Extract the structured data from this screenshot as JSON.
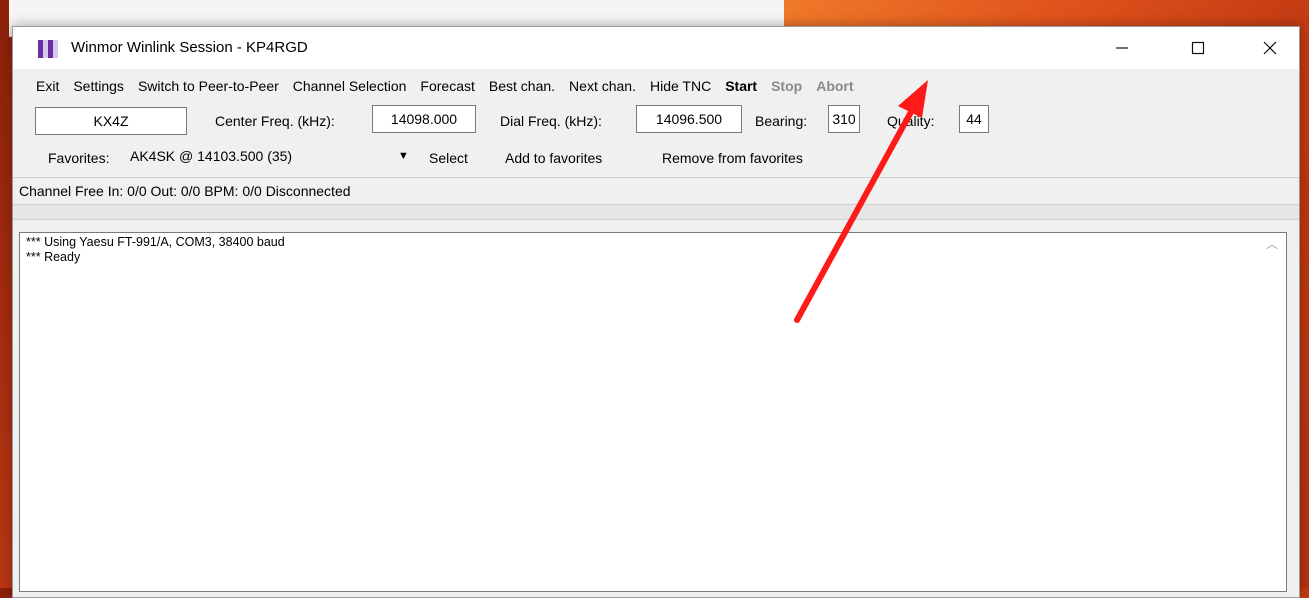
{
  "window": {
    "title": "Winmor Winlink Session - KP4RGD"
  },
  "titlebar_controls": {
    "minimize_icon": "minimize-icon",
    "maximize_icon": "maximize-icon",
    "close_icon": "close-icon"
  },
  "menu": {
    "items": [
      "Exit",
      "Settings",
      "Switch to Peer-to-Peer",
      "Channel Selection",
      "Forecast",
      "Best chan.",
      "Next chan.",
      "Hide TNC",
      "Start",
      "Stop",
      "Abort"
    ]
  },
  "station": {
    "callsign": "KX4Z",
    "center_freq_label": "Center Freq. (kHz):",
    "center_freq": "14098.000",
    "dial_freq_label": "Dial Freq. (kHz):",
    "dial_freq": "14096.500",
    "bearing_label": "Bearing:",
    "bearing": "310",
    "quality_label": "Quality:",
    "quality": "44"
  },
  "favorites": {
    "label": "Favorites:",
    "selected": "AK4SK  @  14103.500  (35)",
    "select_label": "Select",
    "add_label": "Add to favorites",
    "remove_label": "Remove from favorites"
  },
  "status": {
    "text": "Channel Free  In: 0/0  Out: 0/0  BPM: 0/0  Disconnected"
  },
  "log": {
    "lines": [
      "*** Using Yaesu FT-991/A, COM3, 38400 baud",
      "*** Ready"
    ]
  },
  "colors": {
    "annotation_arrow": "#ff1a1a",
    "disabled_text": "#8a8a8a",
    "app_icon_purple": "#6a2ea0"
  }
}
